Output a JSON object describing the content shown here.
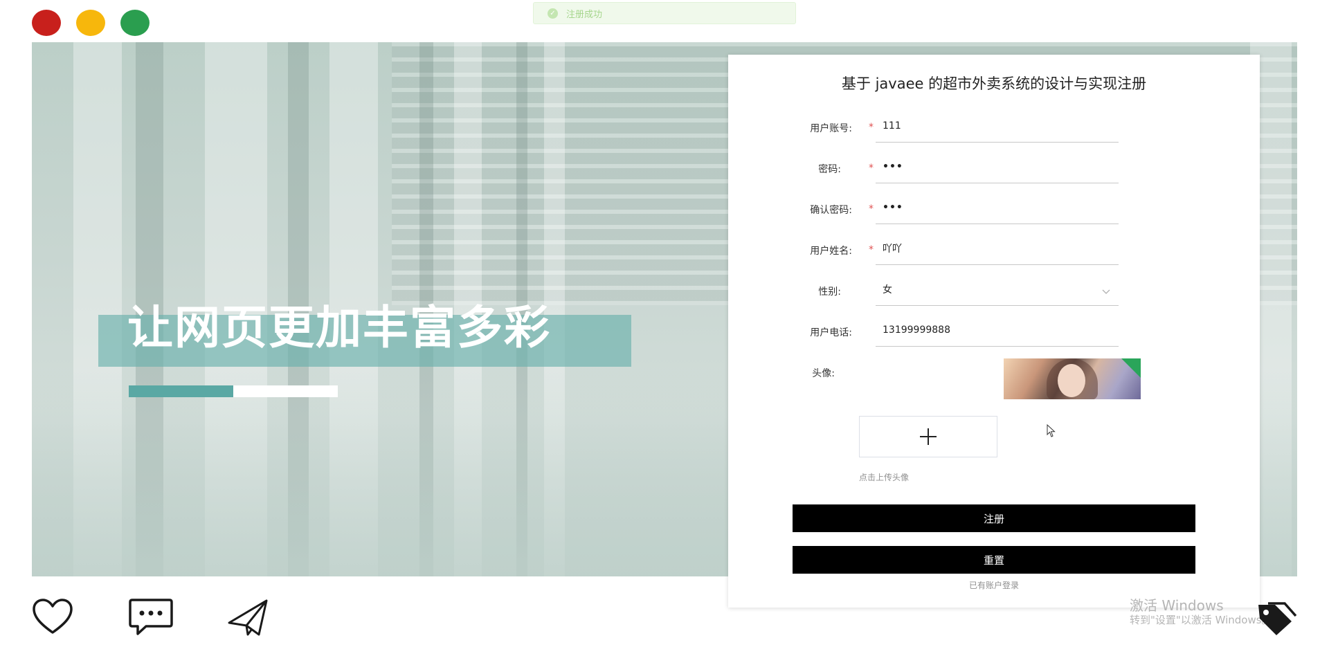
{
  "toast": {
    "icon": "check-circle-icon",
    "text": "注册成功",
    "color": "#a6d68d"
  },
  "hero": {
    "slogan": "让网页更加丰富多彩",
    "band_color": "#6ab0ac",
    "progress_fraction": 0.5,
    "progress_color": "#5aa8a4"
  },
  "window_controls": [
    "red-dot",
    "yellow-dot",
    "green-dot"
  ],
  "form": {
    "title": "基于 javaee 的超市外卖系统的设计与实现注册",
    "fields": [
      {
        "label": "用户账号:",
        "required": "*",
        "value": "111"
      },
      {
        "label": "密码:",
        "required": "*",
        "value": "•••"
      },
      {
        "label": "确认密码:",
        "required": "*",
        "value": "•••"
      },
      {
        "label": "用户姓名:",
        "required": "*",
        "value": "吖吖"
      },
      {
        "label": "性别:",
        "required": "",
        "value": "女"
      },
      {
        "label": "用户电话:",
        "required": "",
        "value": "13199999888"
      }
    ],
    "avatar_label": "头像:",
    "upload_hint": "点击上传头像",
    "register_button": "注册",
    "reset_button": "重置",
    "login_link": "已有账户登录"
  },
  "bottom_icons": [
    "heart-icon",
    "message-icon",
    "send-icon"
  ],
  "watermark": {
    "title": "激活 Windows",
    "subtitle": "转到\"设置\"以激活 Windows。"
  }
}
